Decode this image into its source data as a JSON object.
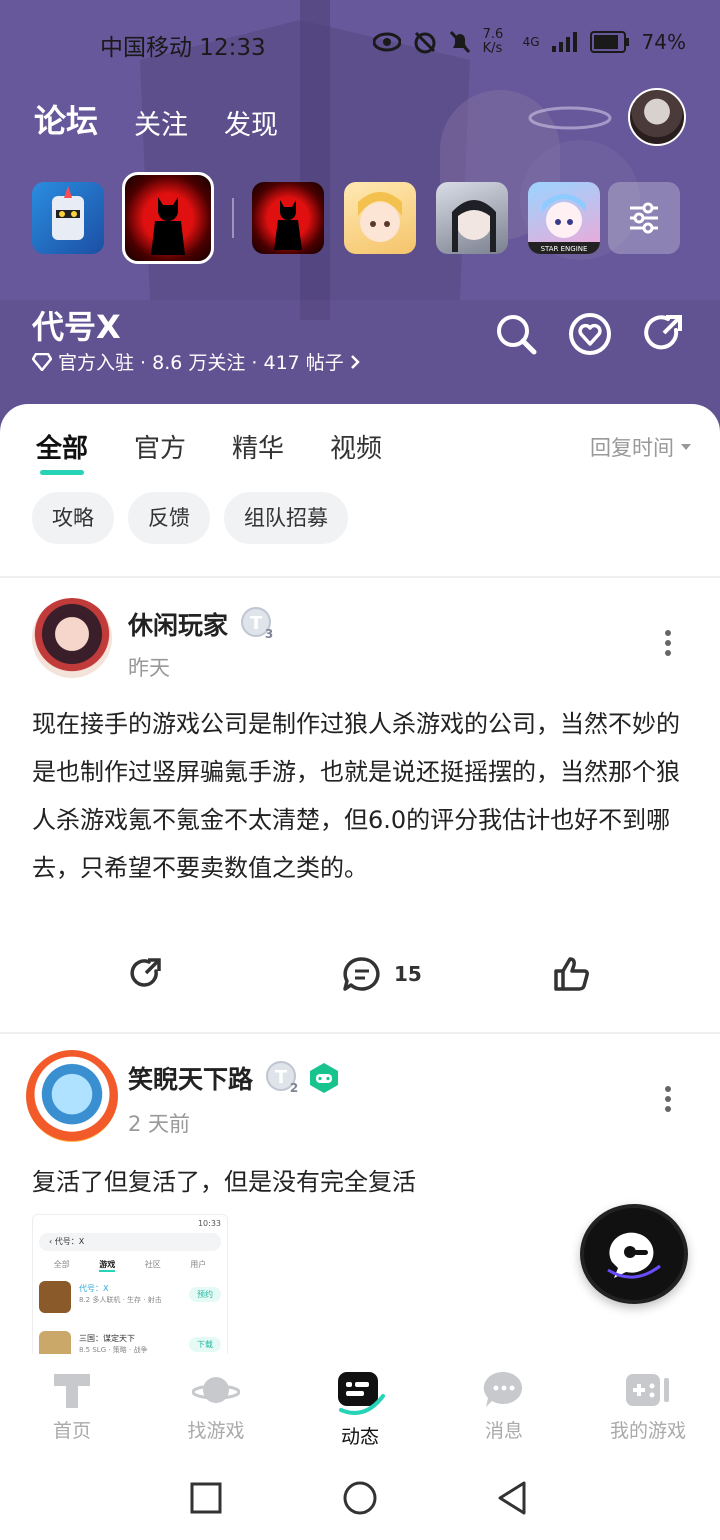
{
  "status_bar": {
    "carrier_time": "中国移动 12:33",
    "net_speed": "7.6 K/s",
    "network": "4G",
    "battery": "74%"
  },
  "top_nav": {
    "tabs": [
      "论坛",
      "关注",
      "发现"
    ],
    "active": "论坛"
  },
  "games_strip": {
    "icons": [
      "knight-game-icon",
      "codename-x-game-icon",
      "red-silhouette-game-icon",
      "blonde-girl-game-icon",
      "dark-hair-girl-game-icon",
      "star-engine-game-icon",
      "filter-icon"
    ]
  },
  "forum": {
    "title": "代号X",
    "meta": "官方入驻 · 8.6 万关注 · 417 帖子"
  },
  "sub_tabs": {
    "items": [
      "全部",
      "官方",
      "精华",
      "视频"
    ],
    "active": "全部",
    "sort_label": "回复时间"
  },
  "chips": [
    "攻略",
    "反馈",
    "组队招募"
  ],
  "posts": [
    {
      "user": "休闲玩家",
      "level": "3",
      "time": "昨天",
      "content": "现在接手的游戏公司是制作过狼人杀游戏的公司，当然不妙的是也制作过竖屏骗氪手游，也就是说还挺摇摆的，当然那个狼人杀游戏氪不氪金不太清楚，但6.0的评分我估计也好不到哪去，只希望不要卖数值之类的。",
      "comments": "15"
    },
    {
      "user": "笑睨天下路",
      "level": "2",
      "time": "2 天前",
      "content": "复活了但复活了，但是没有完全复活",
      "screenshot": {
        "status_time": "10:33",
        "search_text": "代号：X",
        "tabs": [
          "全部",
          "游戏",
          "社区",
          "用户"
        ],
        "items": [
          {
            "name": "代号：X",
            "meta": "8.2 多人联机 · 生存 · 射击",
            "button": "预约"
          },
          {
            "name": "三国：谋定天下",
            "meta": "8.5 SLG · 策略 · 战争",
            "button": "下载"
          }
        ]
      }
    }
  ],
  "bottom_nav": {
    "items": [
      "首页",
      "找游戏",
      "动态",
      "消息",
      "我的游戏"
    ],
    "active": "动态"
  },
  "colors": {
    "accent": "#27d3b7",
    "hero_bg": "#6a5a99",
    "text_primary": "#222222",
    "text_secondary": "#999999"
  }
}
